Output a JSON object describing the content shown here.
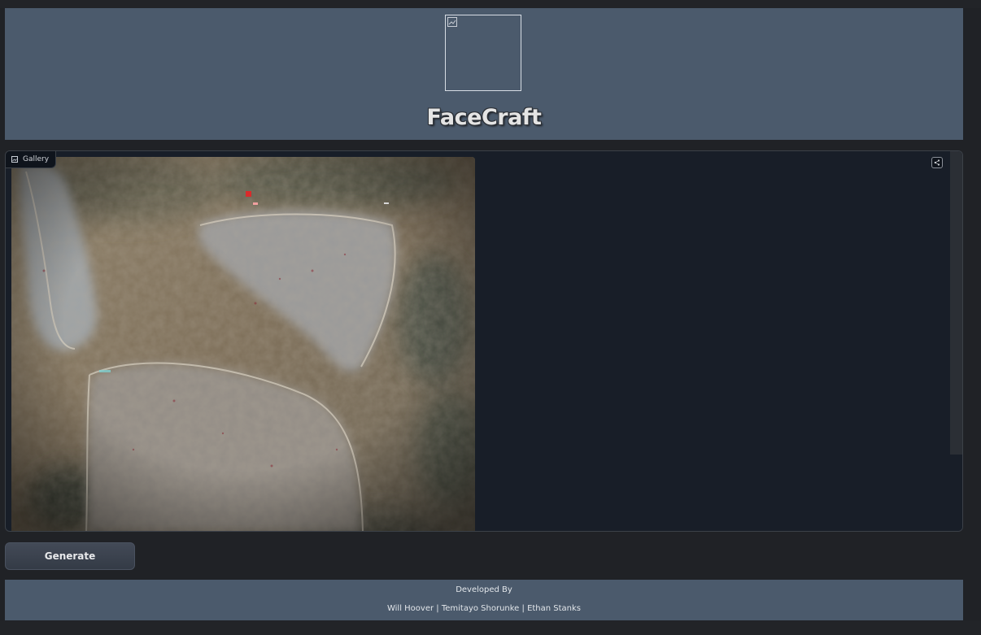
{
  "header": {
    "title": "FaceCraft",
    "logo_icon": "broken-image-icon"
  },
  "gallery": {
    "label": "Gallery",
    "label_icon": "image-icon",
    "share_icon": "share-icon"
  },
  "actions": {
    "generate_label": "Generate"
  },
  "footer": {
    "developed_by": "Developed By",
    "authors": "Will Hoover | Temitayo Shorunke | Ethan Stanks"
  },
  "colors": {
    "header_bg": "#4b5a6c",
    "page_bg": "#202226",
    "gallery_bg": "#181e28"
  }
}
